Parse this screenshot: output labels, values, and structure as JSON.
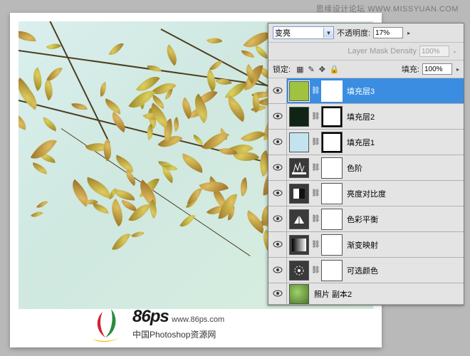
{
  "watermark": {
    "text": "思缘设计论坛 WWW.MISSYUAN.COM"
  },
  "panel": {
    "blend_mode": "变亮",
    "opacity_label": "不透明度:",
    "opacity_value": "17%",
    "mask_density_label": "Layer Mask Density",
    "mask_density_value": "100%",
    "lock_label": "锁定:",
    "fill_label": "填充:",
    "fill_value": "100%"
  },
  "layers": [
    {
      "name": "填充层3",
      "type": "fill",
      "color": "swatch-green",
      "selected": true
    },
    {
      "name": "填充层2",
      "type": "fill",
      "color": "swatch-darkgreen",
      "selected": false
    },
    {
      "name": "填充层1",
      "type": "fill",
      "color": "swatch-lightblue",
      "selected": false
    },
    {
      "name": "色阶",
      "type": "adj",
      "icon": "levels",
      "selected": false
    },
    {
      "name": "亮度对比度",
      "type": "adj",
      "icon": "brightness",
      "selected": false
    },
    {
      "name": "色彩平衡",
      "type": "adj",
      "icon": "balance",
      "selected": false
    },
    {
      "name": "渐变映射",
      "type": "adj",
      "icon": "gradient",
      "selected": false
    },
    {
      "name": "可选颜色",
      "type": "adj",
      "icon": "selective",
      "selected": false
    },
    {
      "name": "照片 副本2",
      "type": "photo",
      "selected": false
    }
  ],
  "logo": {
    "brand": "86",
    "ps": "ps",
    "url": "www.86ps.com",
    "sub": "中国Photoshop资源网"
  }
}
